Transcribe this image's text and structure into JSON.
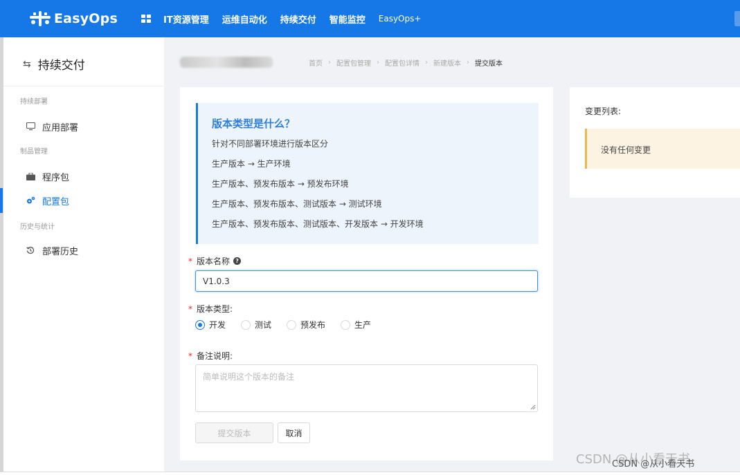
{
  "topnav": {
    "logo": "EasyOps",
    "items": [
      "IT资源管理",
      "运维自动化",
      "持续交付",
      "智能监控"
    ],
    "plus": "EasyOps+"
  },
  "sidebar": {
    "title": "持续交付",
    "groups": [
      "持续部署",
      "制品管理",
      "历史与统计"
    ],
    "items": [
      {
        "label": "应用部署",
        "icon": "monitor-icon"
      },
      {
        "label": "程序包",
        "icon": "briefcase-icon"
      },
      {
        "label": "配置包",
        "icon": "settings-icon",
        "active": true
      },
      {
        "label": "部署历史",
        "icon": "history-icon"
      }
    ]
  },
  "breadcrumb": [
    "首页",
    "配置包管理",
    "配置包详情",
    "新建版本",
    "提交版本"
  ],
  "info": {
    "title": "版本类型是什么？",
    "lines": [
      "针对不同部署环境进行版本区分",
      "生产版本 → 生产环境",
      "生产版本、预发布版本 → 预发布环境",
      "生产版本、预发布版本、测试版本 → 测试环境",
      "生产版本、预发布版本、测试版本、开发版本 → 开发环境"
    ]
  },
  "form": {
    "name_label": "版本名称",
    "name_value": "V1.0.3",
    "type_label": "版本类型:",
    "types": [
      "开发",
      "测试",
      "预发布",
      "生产"
    ],
    "selected_type": "开发",
    "note_label": "备注说明:",
    "note_placeholder": "简单说明这个版本的备注",
    "submit_label": "提交版本",
    "cancel_label": "取消"
  },
  "changes": {
    "title": "变更列表:",
    "empty": "没有任何变更"
  },
  "watermark": {
    "big": "CSDN @从小看天书",
    "small": "CSDN @从小看天书"
  },
  "colors": {
    "brand": "#1677e6",
    "warning_bar": "#f0b54b"
  }
}
